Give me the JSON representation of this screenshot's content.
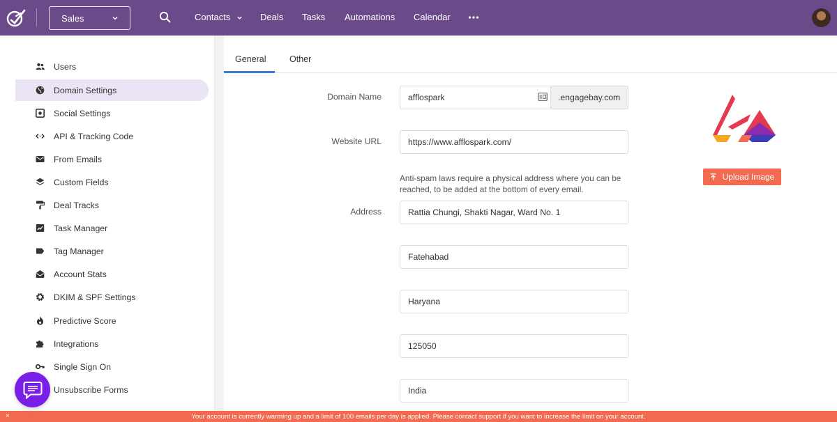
{
  "topbar": {
    "module_select": "Sales",
    "nav": [
      {
        "label": "Contacts",
        "has_dropdown": true
      },
      {
        "label": "Deals"
      },
      {
        "label": "Tasks"
      },
      {
        "label": "Automations"
      },
      {
        "label": "Calendar"
      }
    ],
    "color": "#6b4a8a"
  },
  "sidebar": {
    "active_index": 1,
    "items": [
      {
        "label": "Users",
        "icon": "users-icon"
      },
      {
        "label": "Domain Settings",
        "icon": "globe-icon"
      },
      {
        "label": "Social Settings",
        "icon": "social-icon"
      },
      {
        "label": "API & Tracking Code",
        "icon": "code-icon"
      },
      {
        "label": "From Emails",
        "icon": "envelope-icon"
      },
      {
        "label": "Custom Fields",
        "icon": "layers-icon"
      },
      {
        "label": "Deal Tracks",
        "icon": "paint-roller-icon"
      },
      {
        "label": "Task Manager",
        "icon": "task-icon"
      },
      {
        "label": "Tag Manager",
        "icon": "tag-icon"
      },
      {
        "label": "Account Stats",
        "icon": "envelope-open-icon"
      },
      {
        "label": "DKIM & SPF Settings",
        "icon": "gear-icon"
      },
      {
        "label": "Predictive Score",
        "icon": "fire-icon"
      },
      {
        "label": "Integrations",
        "icon": "puzzle-icon"
      },
      {
        "label": "Single Sign On",
        "icon": "key-icon"
      },
      {
        "label": "Unsubscribe Forms",
        "icon": "form-icon"
      }
    ]
  },
  "tabs": [
    {
      "label": "General",
      "active": true
    },
    {
      "label": "Other"
    }
  ],
  "form": {
    "domain_label": "Domain Name",
    "domain_value": "afflospark",
    "domain_suffix": ".engagebay.com",
    "website_label": "Website URL",
    "website_value": "https://www.afflospark.com/",
    "address_help": "Anti-spam laws require a physical address where you can be reached, to be added at the bottom of every email.",
    "address_label": "Address",
    "address_lines": [
      "Rattia Chungi, Shakti Nagar, Ward No. 1",
      "Fatehabad",
      "Haryana",
      "125050",
      "India"
    ]
  },
  "upload_button": "Upload Image",
  "banner": {
    "text": "Your account is currently warming up and a limit of 100 emails per day is applied. Please contact support if you want to increase the limit on your account.",
    "close": "×",
    "color": "#f26a4f"
  },
  "accent": "#3a7bd5"
}
